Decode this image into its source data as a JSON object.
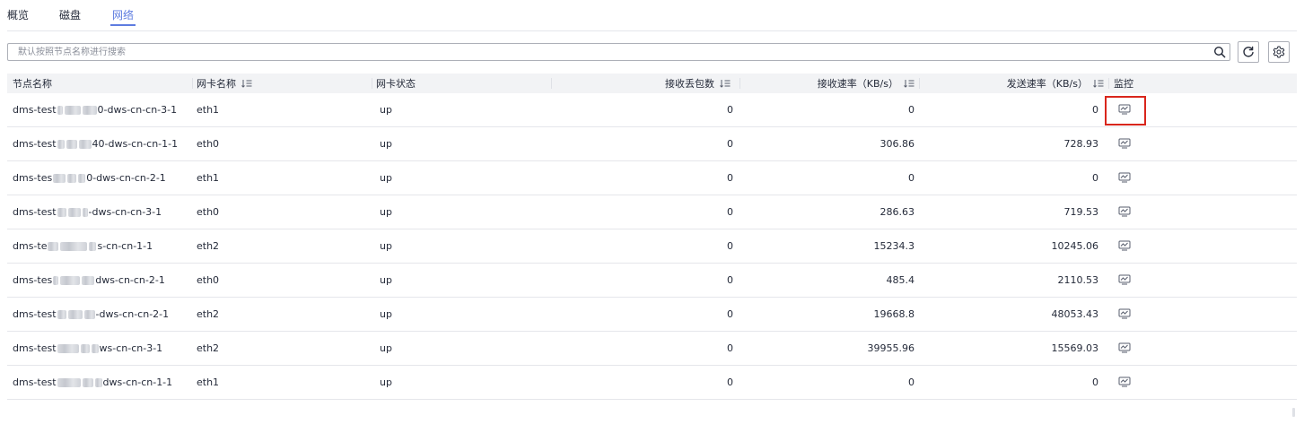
{
  "tabs": [
    {
      "label": "概览",
      "active": false
    },
    {
      "label": "磁盘",
      "active": false
    },
    {
      "label": "网络",
      "active": true
    }
  ],
  "search": {
    "placeholder": "默认按照节点名称进行搜索",
    "value": ""
  },
  "toolbar": {
    "search_icon": "search-icon",
    "refresh_icon": "refresh-icon",
    "settings_icon": "gear-icon"
  },
  "table": {
    "columns": [
      "节点名称",
      "网卡名称",
      "网卡状态",
      "接收丢包数",
      "接收速率（KB/s）",
      "发送速率（KB/s）",
      "监控"
    ],
    "sortable_columns": [
      "网卡名称",
      "接收丢包数",
      "接收速率（KB/s）",
      "发送速率（KB/s）"
    ],
    "rows": [
      {
        "node_prefix": "dms-test",
        "node_suffix": "0-dws-cn-cn-3-1",
        "nic": "eth1",
        "status": "up",
        "rx_drop": "0",
        "rx_rate": "0",
        "tx_rate": "0",
        "highlighted": true
      },
      {
        "node_prefix": "dms-test",
        "node_suffix": "40-dws-cn-cn-1-1",
        "nic": "eth0",
        "status": "up",
        "rx_drop": "0",
        "rx_rate": "306.86",
        "tx_rate": "728.93",
        "highlighted": false
      },
      {
        "node_prefix": "dms-tes",
        "node_suffix": "0-dws-cn-cn-2-1",
        "nic": "eth1",
        "status": "up",
        "rx_drop": "0",
        "rx_rate": "0",
        "tx_rate": "0",
        "highlighted": false
      },
      {
        "node_prefix": "dms-test",
        "node_suffix": "-dws-cn-cn-3-1",
        "nic": "eth0",
        "status": "up",
        "rx_drop": "0",
        "rx_rate": "286.63",
        "tx_rate": "719.53",
        "highlighted": false
      },
      {
        "node_prefix": "dms-te",
        "node_suffix": "s-cn-cn-1-1",
        "nic": "eth2",
        "status": "up",
        "rx_drop": "0",
        "rx_rate": "15234.3",
        "tx_rate": "10245.06",
        "highlighted": false
      },
      {
        "node_prefix": "dms-tes",
        "node_suffix": "dws-cn-cn-2-1",
        "nic": "eth0",
        "status": "up",
        "rx_drop": "0",
        "rx_rate": "485.4",
        "tx_rate": "2110.53",
        "highlighted": false
      },
      {
        "node_prefix": "dms-test",
        "node_suffix": "-dws-cn-cn-2-1",
        "nic": "eth2",
        "status": "up",
        "rx_drop": "0",
        "rx_rate": "19668.8",
        "tx_rate": "48053.43",
        "highlighted": false
      },
      {
        "node_prefix": "dms-test",
        "node_suffix": "ws-cn-cn-3-1",
        "nic": "eth2",
        "status": "up",
        "rx_drop": "0",
        "rx_rate": "39955.96",
        "tx_rate": "15569.03",
        "highlighted": false
      },
      {
        "node_prefix": "dms-test",
        "node_suffix": "dws-cn-cn-1-1",
        "nic": "eth1",
        "status": "up",
        "rx_drop": "0",
        "rx_rate": "0",
        "tx_rate": "0",
        "highlighted": false
      }
    ]
  },
  "colors": {
    "accent": "#5e7ce0",
    "highlight": "#d9261c",
    "border": "#e5e6eb",
    "header_bg": "#f2f3f5"
  }
}
